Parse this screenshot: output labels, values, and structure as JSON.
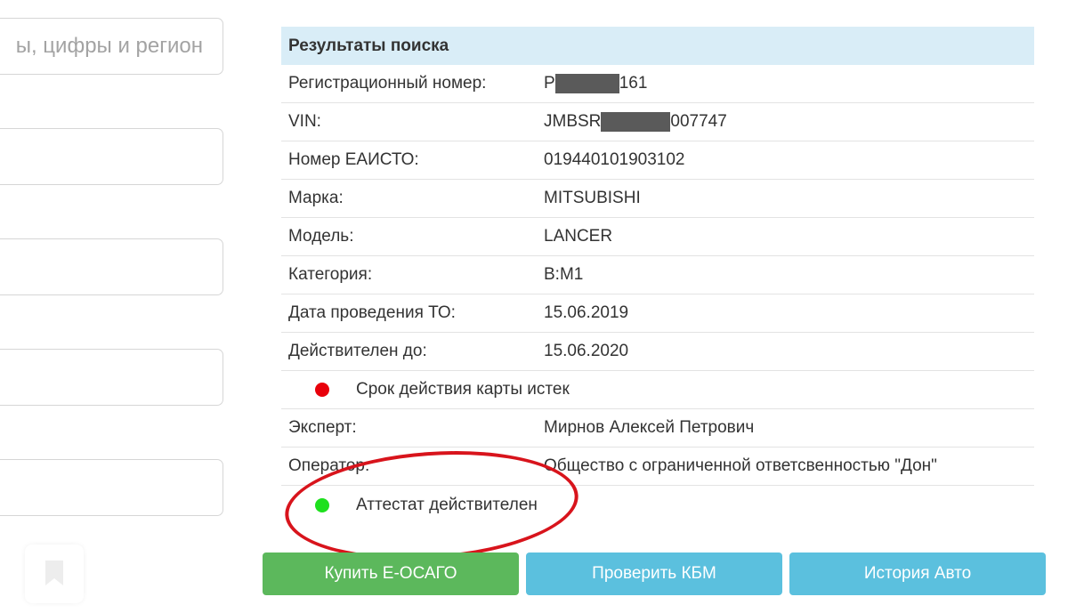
{
  "form": {
    "plate_placeholder": "ы, цифры и регион"
  },
  "results": {
    "title": "Результаты поиска",
    "rows": [
      {
        "label": "Регистрационный номер:",
        "value_pre": "Р",
        "value_post": "161"
      },
      {
        "label": "VIN:",
        "value_pre": "JMBSR",
        "value_post": "007747"
      },
      {
        "label": "Номер ЕАИСТО:",
        "value": "019440101903102"
      },
      {
        "label": "Марка:",
        "value": "MITSUBISHI"
      },
      {
        "label": "Модель:",
        "value": "LANCER"
      },
      {
        "label": "Категория:",
        "value": "B:M1"
      },
      {
        "label": "Дата проведения ТО:",
        "value": "15.06.2019"
      },
      {
        "label": "Действителен до:",
        "value": "15.06.2020"
      }
    ],
    "card_status": {
      "text": "Срок действия карты истек",
      "color": "#e8000b"
    },
    "expert": {
      "label": "Эксперт:",
      "value": "Мирнов Алексей Петрович"
    },
    "operator": {
      "label": "Оператор:",
      "value": "Общество с ограниченной ответсвенностью \"Дон\""
    },
    "attestat_status": {
      "text": "Аттестат действителен",
      "color": "#1ee01e"
    }
  },
  "buttons": {
    "buy": "Купить Е-ОСАГО",
    "check_kbm": "Проверить КБМ",
    "history": "История Авто"
  },
  "colors": {
    "header_bg": "#d9edf7",
    "green_button": "#5cb85c",
    "blue_button": "#5bc0de",
    "annotation": "#d8141c"
  }
}
